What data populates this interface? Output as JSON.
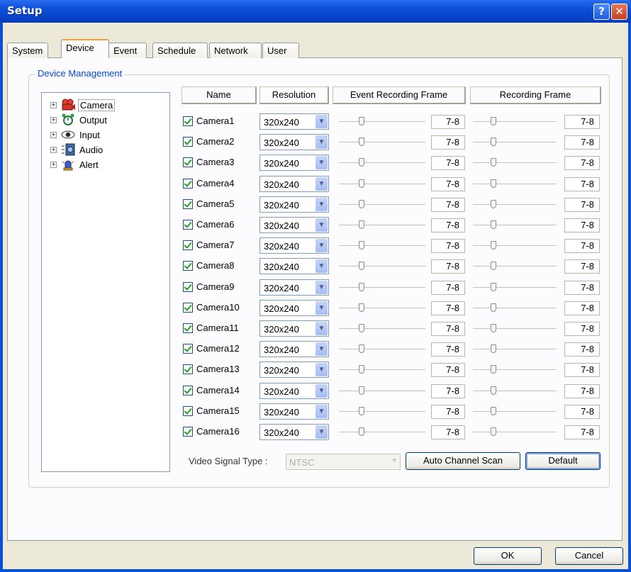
{
  "window": {
    "title": "Setup",
    "help_glyph": "?",
    "close_glyph": "✕"
  },
  "tabs": [
    "System",
    "Device",
    "Event",
    "Schedule",
    "Network",
    "User"
  ],
  "active_tab": "Device",
  "group_title": "Device Management",
  "tree": [
    {
      "label": "Camera",
      "icon": "camera-icon",
      "selected": true
    },
    {
      "label": "Output",
      "icon": "output-alarm-icon",
      "selected": false
    },
    {
      "label": "Input",
      "icon": "input-eye-icon",
      "selected": false
    },
    {
      "label": "Audio",
      "icon": "audio-speaker-icon",
      "selected": false
    },
    {
      "label": "Alert",
      "icon": "alert-siren-icon",
      "selected": false
    }
  ],
  "headers": {
    "name": "Name",
    "resolution": "Resolution",
    "event_frame": "Event Recording Frame",
    "rec_frame": "Recording Frame"
  },
  "cameras": [
    {
      "name": "Camera1",
      "checked": true,
      "resolution": "320x240",
      "event_frame": "7-8",
      "rec_frame": "7-8"
    },
    {
      "name": "Camera2",
      "checked": true,
      "resolution": "320x240",
      "event_frame": "7-8",
      "rec_frame": "7-8"
    },
    {
      "name": "Camera3",
      "checked": true,
      "resolution": "320x240",
      "event_frame": "7-8",
      "rec_frame": "7-8"
    },
    {
      "name": "Camera4",
      "checked": true,
      "resolution": "320x240",
      "event_frame": "7-8",
      "rec_frame": "7-8"
    },
    {
      "name": "Camera5",
      "checked": true,
      "resolution": "320x240",
      "event_frame": "7-8",
      "rec_frame": "7-8"
    },
    {
      "name": "Camera6",
      "checked": true,
      "resolution": "320x240",
      "event_frame": "7-8",
      "rec_frame": "7-8"
    },
    {
      "name": "Camera7",
      "checked": true,
      "resolution": "320x240",
      "event_frame": "7-8",
      "rec_frame": "7-8"
    },
    {
      "name": "Camera8",
      "checked": true,
      "resolution": "320x240",
      "event_frame": "7-8",
      "rec_frame": "7-8"
    },
    {
      "name": "Camera9",
      "checked": true,
      "resolution": "320x240",
      "event_frame": "7-8",
      "rec_frame": "7-8"
    },
    {
      "name": "Camera10",
      "checked": true,
      "resolution": "320x240",
      "event_frame": "7-8",
      "rec_frame": "7-8"
    },
    {
      "name": "Camera11",
      "checked": true,
      "resolution": "320x240",
      "event_frame": "7-8",
      "rec_frame": "7-8"
    },
    {
      "name": "Camera12",
      "checked": true,
      "resolution": "320x240",
      "event_frame": "7-8",
      "rec_frame": "7-8"
    },
    {
      "name": "Camera13",
      "checked": true,
      "resolution": "320x240",
      "event_frame": "7-8",
      "rec_frame": "7-8"
    },
    {
      "name": "Camera14",
      "checked": true,
      "resolution": "320x240",
      "event_frame": "7-8",
      "rec_frame": "7-8"
    },
    {
      "name": "Camera15",
      "checked": true,
      "resolution": "320x240",
      "event_frame": "7-8",
      "rec_frame": "7-8"
    },
    {
      "name": "Camera16",
      "checked": true,
      "resolution": "320x240",
      "event_frame": "7-8",
      "rec_frame": "7-8"
    }
  ],
  "video_signal": {
    "label": "Video Signal Type :",
    "value": "NTSC",
    "disabled": true
  },
  "buttons": {
    "auto_scan": "Auto Channel Scan",
    "default": "Default",
    "ok": "OK",
    "cancel": "Cancel"
  },
  "colors": {
    "titlebar": "#0a4fd6",
    "group_title": "#0046d5",
    "checkmark": "#21a121",
    "active_tab_accent": "#f4a430"
  }
}
